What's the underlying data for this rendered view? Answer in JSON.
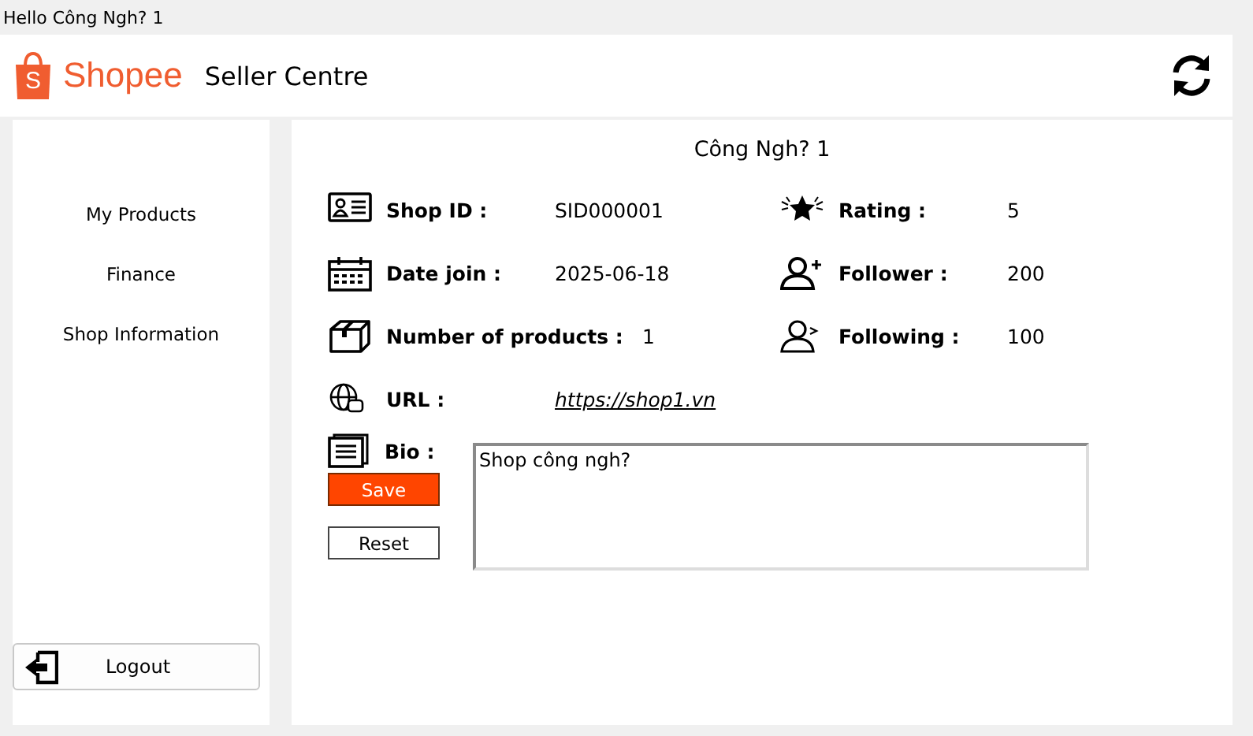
{
  "window": {
    "title": "Hello Công Ngh? 1"
  },
  "header": {
    "logo_mark": "S",
    "logo_text": "Shopee",
    "title": "Seller Centre"
  },
  "sidebar": {
    "items": [
      {
        "label": "My Products"
      },
      {
        "label": "Finance"
      },
      {
        "label": "Shop Information"
      }
    ],
    "logout": "Logout"
  },
  "shop": {
    "name": "Công Ngh? 1",
    "left_fields": [
      {
        "label": "Shop ID :",
        "value": "SID000001",
        "kind": "text"
      },
      {
        "label": "Date join :",
        "value": "2025-06-18",
        "kind": "text"
      },
      {
        "label": "Number of products :",
        "value": "1",
        "kind": "text"
      },
      {
        "label": "URL :",
        "value": "https://shop1.vn",
        "kind": "link"
      }
    ],
    "right_fields": [
      {
        "label": "Rating :",
        "value": "5",
        "kind": "text"
      },
      {
        "label": "Follower :",
        "value": "200",
        "kind": "text"
      },
      {
        "label": "Following :",
        "value": "100",
        "kind": "text"
      }
    ],
    "bio": {
      "label": "Bio :",
      "value": "Shop công ngh?"
    },
    "buttons": [
      {
        "label": "Save",
        "kind": "primary"
      },
      {
        "label": "Reset",
        "kind": "secondary"
      }
    ]
  }
}
